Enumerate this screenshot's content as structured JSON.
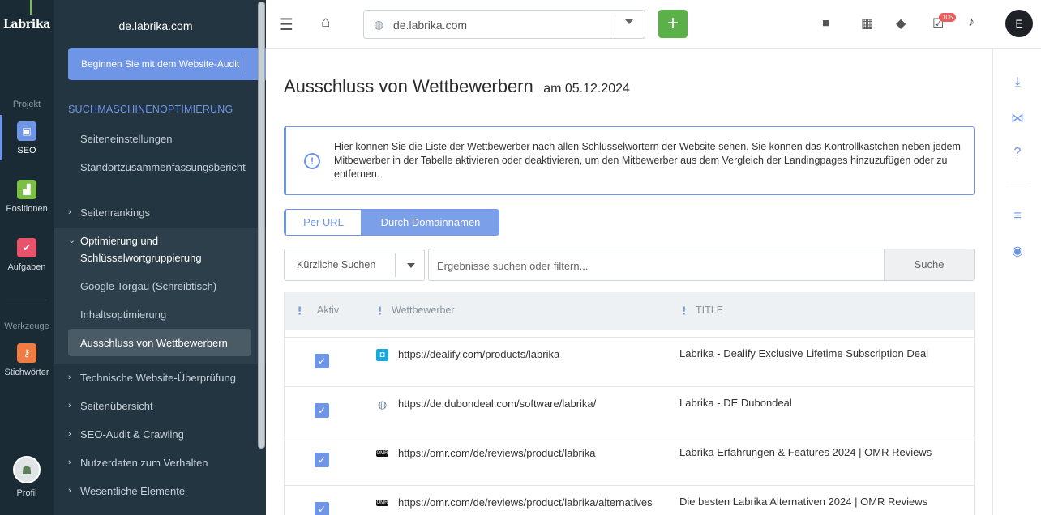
{
  "rail": {
    "logo": "Labrika",
    "section_project": "Projekt",
    "section_tools": "Werkzeuge",
    "items": [
      {
        "label": "SEO",
        "icon": "seo-icon",
        "color": "#6f95e6"
      },
      {
        "label": "Positionen",
        "icon": "chart-icon",
        "color": "#7cc043"
      },
      {
        "label": "Aufgaben",
        "icon": "check-icon",
        "color": "#e8536b"
      },
      {
        "label": "Stichwörter",
        "icon": "key-icon",
        "color": "#ef7d43"
      },
      {
        "label": "Profil",
        "icon": "profile-icon"
      }
    ]
  },
  "menu": {
    "domain": "de.labrika.com",
    "audit_button": "Beginnen Sie mit dem Website-Audit",
    "category": "SUCHMASCHINENOPTIMIERUNG",
    "items": [
      {
        "label": "Seiteneinstellungen"
      },
      {
        "label": "Standortzusammenfassungsbericht"
      },
      {
        "label": "Seitenrankings"
      },
      {
        "label": "Optimierung und Schlüsselwortgruppierung"
      },
      {
        "label": "Google Torgau (Schreibtisch)"
      },
      {
        "label": "Inhaltsoptimierung"
      },
      {
        "label": "Ausschluss von Wettbewerbern"
      },
      {
        "label": "Technische Website-Überprüfung"
      },
      {
        "label": "Seitenübersicht"
      },
      {
        "label": "SEO-Audit & Crawling"
      },
      {
        "label": "Nutzerdaten zum Verhalten"
      },
      {
        "label": "Wesentliche Elemente"
      }
    ]
  },
  "topbar": {
    "url": "de.labrika.com",
    "tasks_badge": "105",
    "avatar_initial": "E"
  },
  "page": {
    "title": "Ausschluss von Wettbewerbern",
    "date": "am 05.12.2024",
    "info": "Hier können Sie die Liste der Wettbewerber nach allen Schlüsselwörtern der Website sehen. Sie können das Kontrollkästchen neben jedem Mitbewerber in der Tabelle aktivieren oder deaktivieren, um den Mitbewerber aus dem Vergleich der Landingpages hinzuzufügen oder zu entfernen.",
    "toggle_url": "Per URL",
    "toggle_domain": "Durch Domainnamen",
    "recent": "Kürzliche Suchen",
    "search_placeholder": "Ergebnisse suchen oder filtern...",
    "search_button": "Suche"
  },
  "table": {
    "headers": [
      "Aktiv",
      "Wettbewerber",
      "TITLE"
    ],
    "rows": [
      {
        "active": true,
        "url": "https://dealify.com/products/labrika",
        "title": "Labrika - Dealify Exclusive Lifetime Subscription Deal",
        "favicon": "dealify-icon"
      },
      {
        "active": true,
        "url": "https://de.dubondeal.com/software/labrika/",
        "title": "Labrika - DE Dubondeal",
        "favicon": "globe-icon"
      },
      {
        "active": true,
        "url": "https://omr.com/de/reviews/product/labrika",
        "title": "Labrika Erfahrungen & Features 2024 | OMR Reviews",
        "favicon": "omr-icon"
      },
      {
        "active": true,
        "url": "https://omr.com/de/reviews/product/labrika/alternatives",
        "title": "Die besten Labrika Alternativen 2024 | OMR Reviews",
        "favicon": "omr-icon"
      }
    ]
  }
}
